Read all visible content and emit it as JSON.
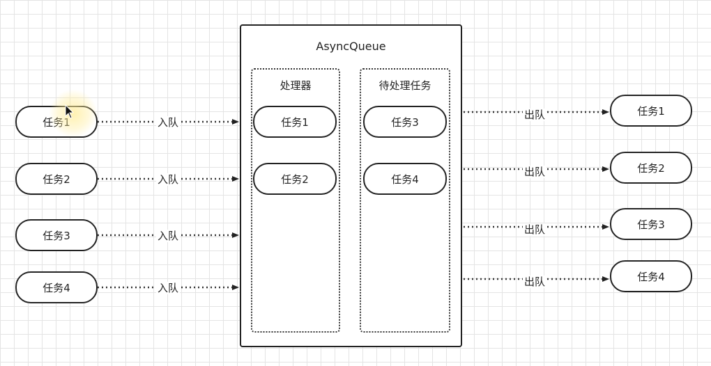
{
  "queue": {
    "title": "AsyncQueue",
    "processor": {
      "title": "处理器",
      "items": [
        "任务1",
        "任务2"
      ]
    },
    "pending": {
      "title": "待处理任务",
      "items": [
        "任务3",
        "任务4"
      ]
    }
  },
  "inputs": [
    "任务1",
    "任务2",
    "任务3",
    "任务4"
  ],
  "outputs": [
    "任务1",
    "任务2",
    "任务3",
    "任务4"
  ],
  "enqueue_label": "入队",
  "dequeue_label": "出队"
}
